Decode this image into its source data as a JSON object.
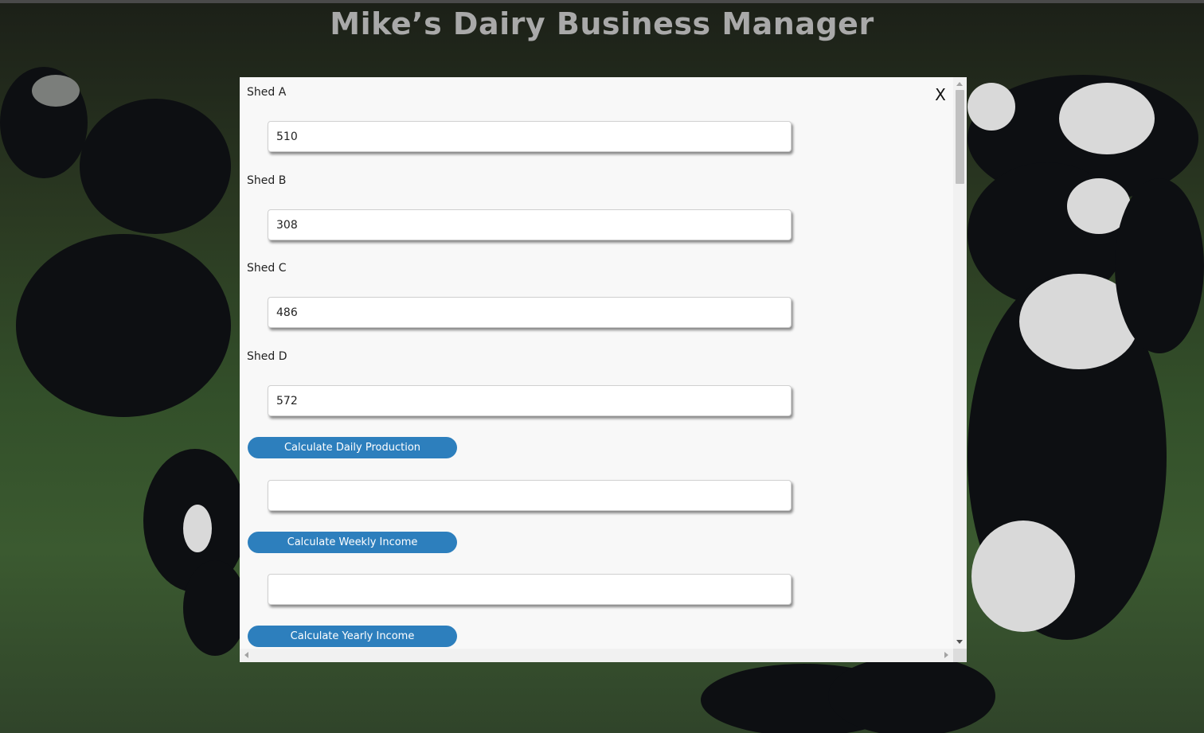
{
  "app": {
    "title": "Mike’s Dairy Business Manager"
  },
  "modal": {
    "close_label": "X",
    "fields": [
      {
        "label": "Shed A",
        "value": "510"
      },
      {
        "label": "Shed B",
        "value": "308"
      },
      {
        "label": "Shed C",
        "value": "486"
      },
      {
        "label": "Shed D",
        "value": "572"
      }
    ],
    "buttons": {
      "daily_production": "Calculate Daily Production",
      "weekly_income": "Calculate Weekly Income",
      "yearly_income": "Calculate Yearly Income"
    },
    "results": {
      "daily_production": "",
      "weekly_income": ""
    }
  },
  "colors": {
    "button_bg": "#2d7fbd",
    "title_text": "#a9a9a9",
    "modal_bg": "#f8f8f8"
  }
}
